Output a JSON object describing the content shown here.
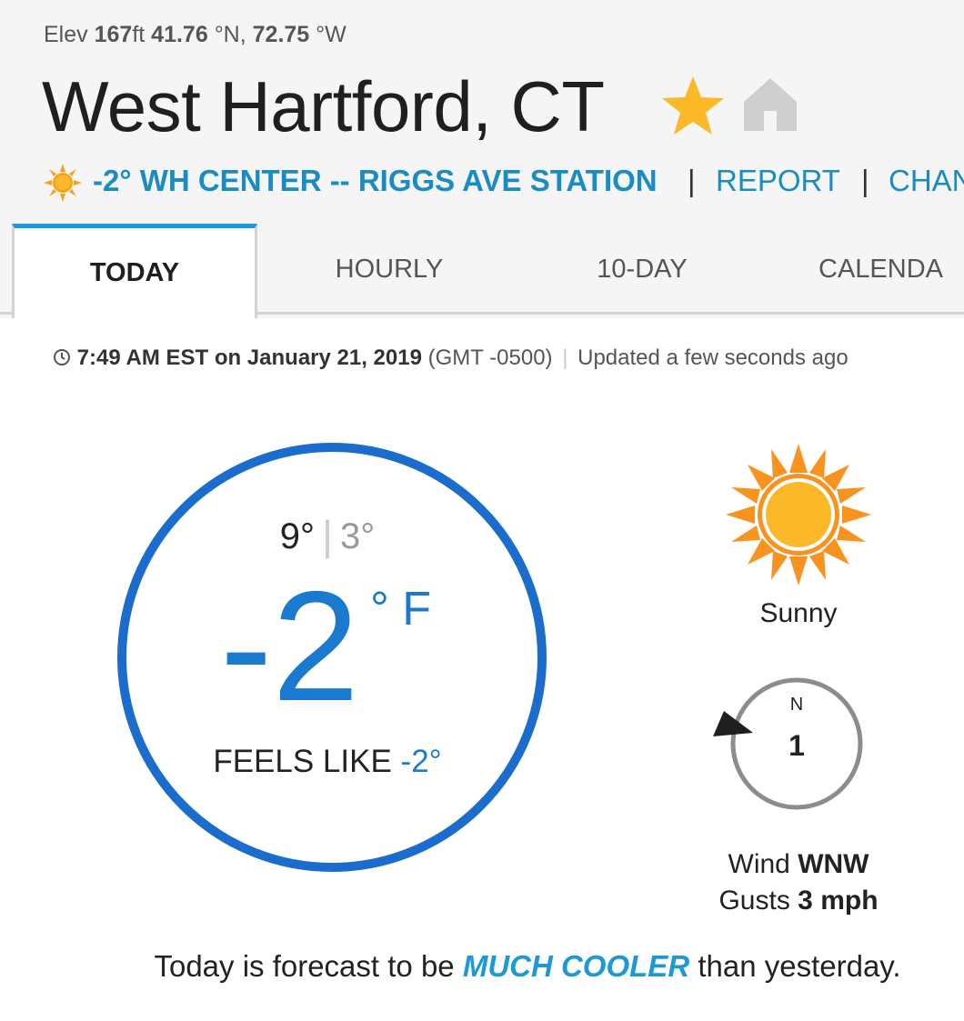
{
  "location": {
    "elev_label": "Elev",
    "elev_value": "167",
    "elev_unit": "ft",
    "lat_value": "41.76",
    "lat_unit": "°N,",
    "lon_value": "72.75",
    "lon_unit": "°W",
    "city": "West Hartford, CT"
  },
  "station": {
    "icon": "sun-icon",
    "link_text": "-2° WH CENTER -- RIGGS AVE STATION",
    "separator": "|",
    "report_text": "REPORT",
    "change_text": "CHAN"
  },
  "icons": {
    "favorite": "star-icon",
    "home": "home-icon",
    "clock": "clock-icon"
  },
  "colors": {
    "accent": "#1a7ad0",
    "link": "#1a8cc4",
    "tab_active": "#1b9ad6",
    "star": "#fbb829",
    "sun": "#f7a11a"
  },
  "tabs": [
    {
      "label": "TODAY",
      "active": true
    },
    {
      "label": "HOURLY",
      "active": false
    },
    {
      "label": "10-DAY",
      "active": false
    },
    {
      "label": "CALENDA",
      "active": false
    }
  ],
  "update": {
    "time": "7:49 AM EST on January 21, 2019",
    "gmt": "(GMT -0500)",
    "separator": "|",
    "updated": "Updated a few seconds ago"
  },
  "current": {
    "high": "9°",
    "low": "3°",
    "temp": "-2",
    "unit": "° F",
    "feels_label": "FEELS LIKE",
    "feels_value": "-2°"
  },
  "condition": {
    "icon": "sun-icon",
    "label": "Sunny"
  },
  "wind": {
    "compass_label": "N",
    "speed": "1",
    "direction_label": "Wind",
    "direction": "WNW",
    "gusts_label": "Gusts",
    "gusts_value": "3 mph"
  },
  "forecast": {
    "prefix": "Today is forecast to be",
    "emphasis": "MUCH COOLER",
    "suffix": "than yesterday."
  }
}
